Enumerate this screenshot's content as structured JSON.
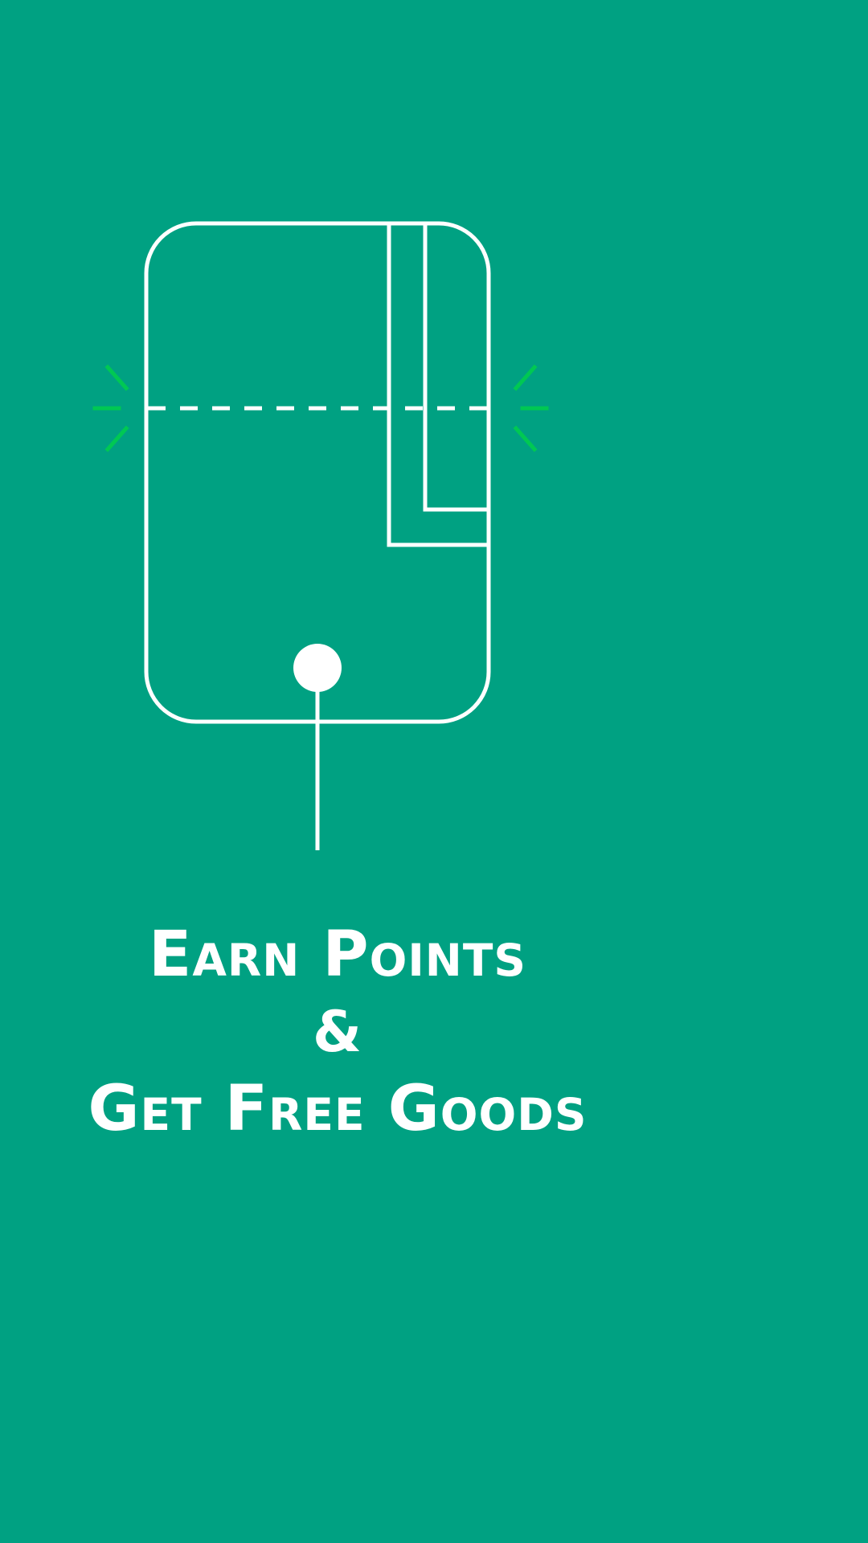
{
  "theme": {
    "background": "#00a182",
    "line": "#ffffff",
    "accent": "#00c853"
  },
  "illustration": {
    "icon": "wallet-card-icon",
    "spark_icon": "sparkle-icon"
  },
  "headline": {
    "line1": "Earn Points",
    "line2": "&",
    "line3": "Get Free Goods"
  }
}
